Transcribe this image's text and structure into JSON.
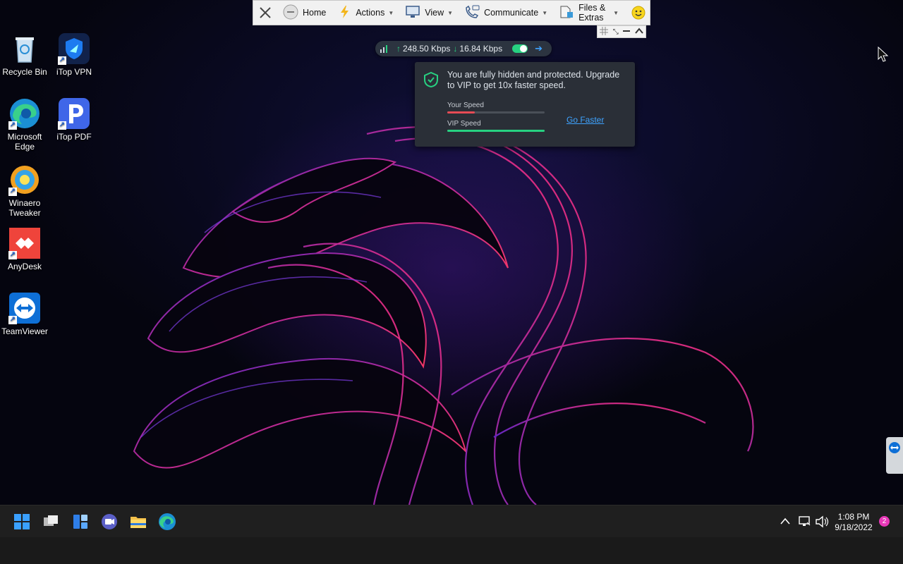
{
  "colors": {
    "accent_green": "#27d181",
    "your_speed_red": "#e64b55",
    "link_blue": "#3ea3ff",
    "notification_pink": "#e838b8"
  },
  "desktop_icons": [
    {
      "label": "Recycle Bin",
      "icon": "recycle-bin-icon"
    },
    {
      "label": "iTop VPN",
      "icon": "itop-vpn-icon"
    },
    {
      "label": "Microsoft Edge",
      "icon": "edge-icon"
    },
    {
      "label": "iTop PDF",
      "icon": "itop-pdf-icon"
    },
    {
      "label": "Winaero Tweaker",
      "icon": "winaero-tweaker-icon"
    },
    {
      "label": "AnyDesk",
      "icon": "anydesk-icon"
    },
    {
      "label": "TeamViewer",
      "icon": "teamviewer-icon"
    }
  ],
  "toolbar": {
    "close_icon": "close-icon",
    "home": "Home",
    "actions": "Actions",
    "view": "View",
    "communicate": "Communicate",
    "files_extras": "Files & Extras",
    "emoji_icon": "smiley-icon"
  },
  "vpn": {
    "upload": "248.50 Kbps",
    "download": "16.84 Kbps",
    "connected": true,
    "message": "You are fully hidden and protected. Upgrade to VIP to get 10x faster speed.",
    "your_speed_label": "Your Speed",
    "your_speed_fraction": 0.28,
    "vip_speed_label": "VIP Speed",
    "vip_speed_fraction": 1.0,
    "go_faster": "Go Faster"
  },
  "taskbar": {
    "apps": [
      "start-icon",
      "task-view-icon",
      "widgets-icon",
      "chat-icon",
      "file-explorer-icon",
      "edge-icon"
    ]
  },
  "tray": {
    "time": "1:08 PM",
    "date": "9/18/2022",
    "notification_count": "2"
  }
}
